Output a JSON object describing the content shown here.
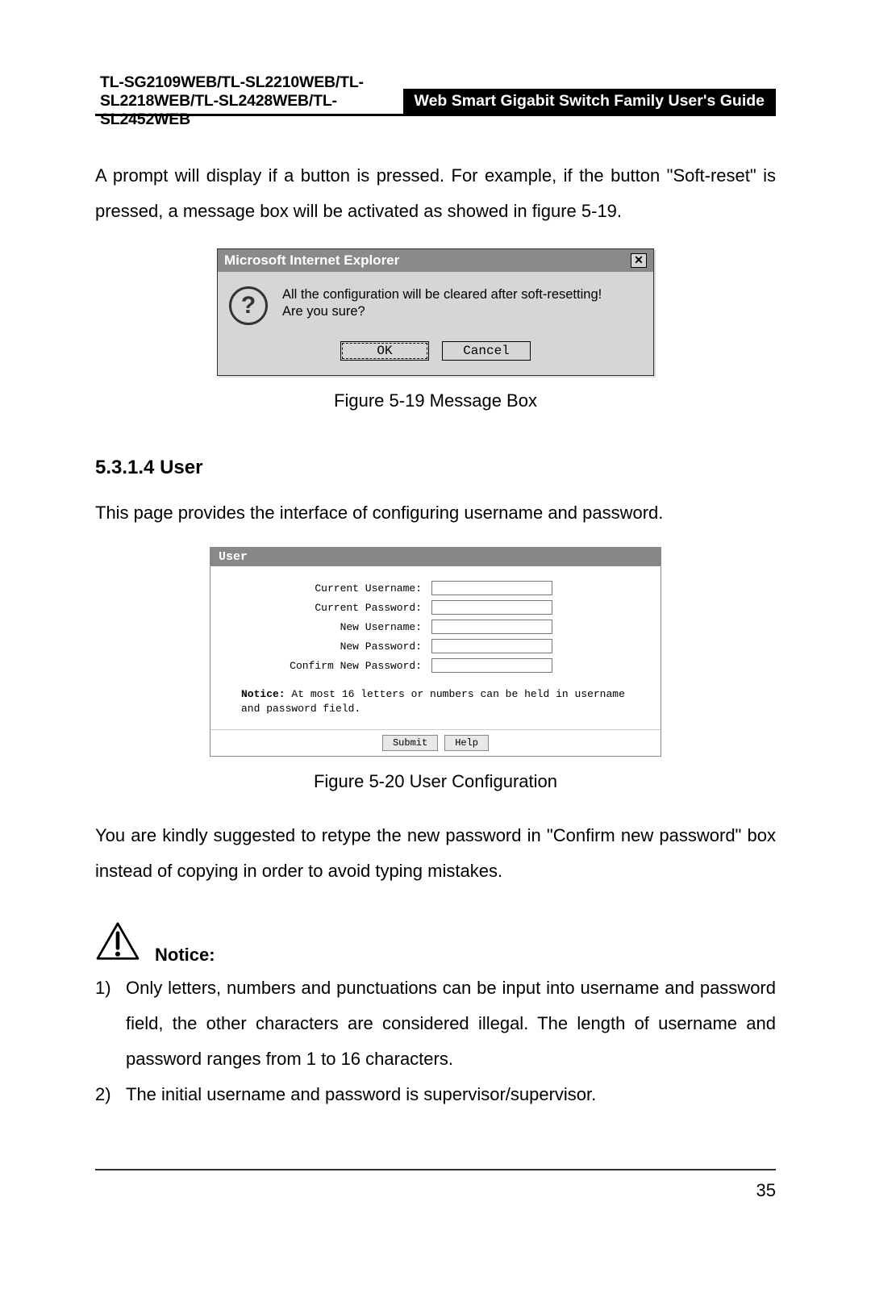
{
  "header": {
    "models": "TL-SG2109WEB/TL-SL2210WEB/TL-SL2218WEB/TL-SL2428WEB/TL-SL2452WEB",
    "guide": "Web Smart Gigabit Switch Family User's Guide"
  },
  "para1": "A prompt will display if a button is pressed. For example, if the button \"Soft-reset\" is pressed, a message box will be activated as showed in figure 5-19.",
  "messagebox": {
    "title": "Microsoft Internet Explorer",
    "close_symbol": "✕",
    "icon_glyph": "?",
    "line1": "All the configuration will be cleared after soft-resetting!",
    "line2": "Are you sure?",
    "ok": "OK",
    "cancel": "Cancel"
  },
  "caption1": "Figure 5-19  Message Box",
  "section_heading": "5.3.1.4  User",
  "para2": "This page provides the interface of configuring username and password.",
  "userpanel": {
    "title": "User",
    "fields": {
      "f0": "Current Username:",
      "f1": "Current Password:",
      "f2": "New Username:",
      "f3": "New Password:",
      "f4": "Confirm New Password:"
    },
    "notice_label": "Notice:",
    "notice_text": "At most 16 letters or numbers can be held in username and password field.",
    "submit": "Submit",
    "help": "Help"
  },
  "caption2": "Figure 5-20  User Configuration",
  "para3": "You are kindly suggested to retype the new password in \"Confirm new password\" box instead of copying in order to avoid typing mistakes.",
  "notice_heading": "Notice:",
  "list": {
    "n1": "1)",
    "t1": "Only letters, numbers and punctuations can be input into username and password field, the other characters are considered illegal. The length of username and password ranges from 1 to 16 characters.",
    "n2": "2)",
    "t2": "The initial username and password is supervisor/supervisor."
  },
  "page_number": "35"
}
